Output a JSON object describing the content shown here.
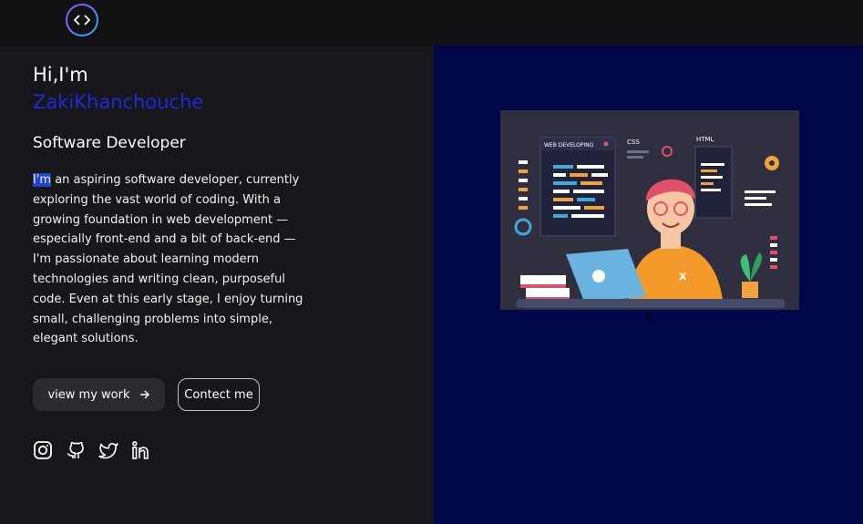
{
  "header": {
    "logo_icon": "code-brackets-icon"
  },
  "hero": {
    "greeting": "Hi,I'm",
    "name": "ZakiKhanchouche",
    "role": "Software Developer",
    "about_highlight": "I'm",
    "about_rest": " an aspiring software developer, currently exploring the vast world of coding. With a growing foundation in web development — especially front-end and a bit of back-end — I'm passionate about learning modern technologies and writing clean, purposeful code. Even at this early stage, I enjoy turning small, challenging problems into simple, elegant solutions."
  },
  "buttons": {
    "work_label": "view my work",
    "contact_label": "Contect me"
  },
  "socials": [
    "instagram-icon",
    "github-icon",
    "twitter-icon",
    "linkedin-icon"
  ],
  "illustration": {
    "web_developing": "WEB DEVELOPING",
    "css": "CSS",
    "html": "HTML"
  },
  "colors": {
    "accent": "#1e28d6",
    "right_panel": "#02074a",
    "left_panel": "#17171b"
  }
}
